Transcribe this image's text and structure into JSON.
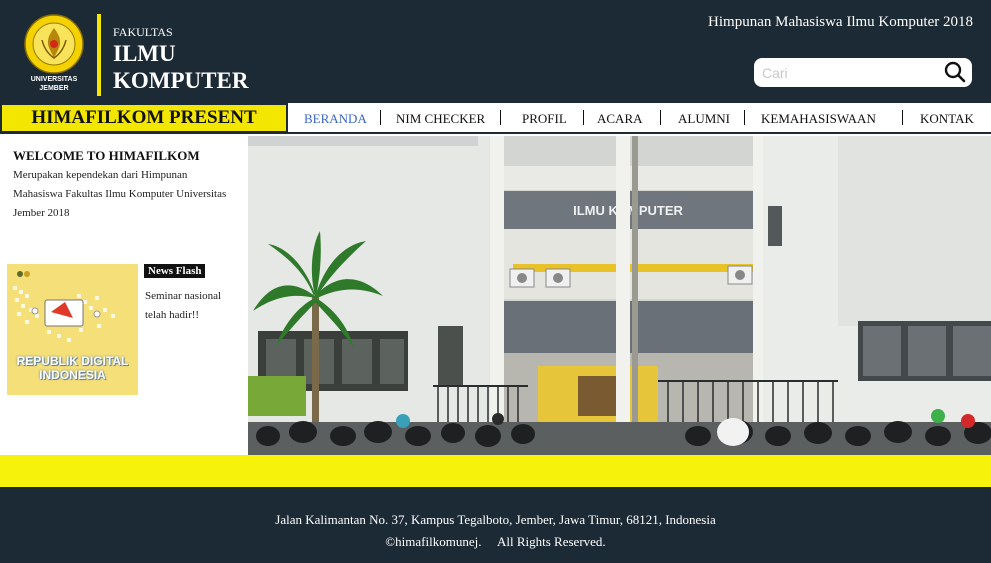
{
  "header": {
    "logo_text_line1": "UNIVERSITAS",
    "logo_text_line2": "JEMBER",
    "faculty_small": "FAKULTAS",
    "faculty_line1": "ILMU",
    "faculty_line2": "KOMPUTER",
    "org_title": "Himpunan Mahasiswa Ilmu Komputer 2018",
    "search_placeholder": "Cari"
  },
  "nav": {
    "present_label": "HIMAFILKOM PRESENT",
    "items": [
      "BERANDA",
      "NIM CHECKER",
      "PROFIL",
      "ACARA",
      "ALUMNI",
      "KEMAHASISWAAN",
      "KONTAK"
    ],
    "active": "BERANDA"
  },
  "sidebar": {
    "welcome_title": "WELCOME TO HIMAFILKOM",
    "welcome_text": "Merupakan kependekan dari Himpunan Mahasiswa Fakultas Ilmu Komputer Universitas Jember 2018",
    "thumb_caption_line1": "REPUBLIK DIGITAL",
    "thumb_caption_line2": "INDONESIA",
    "news_badge": "News Flash",
    "news_text": "Seminar nasional telah hadir!!"
  },
  "hero": {
    "building_sign": "ILMU KOMPUTER"
  },
  "footer": {
    "address": "Jalan Kalimantan No. 37, Kampus Tegalboto, Jember, Jawa Timur, 68121, Indonesia",
    "copyright": "©himafilkomunej.     All Rights Reserved."
  },
  "colors": {
    "dark": "#1c2a36",
    "yellow": "#f3e600",
    "band_yellow": "#f7f20c",
    "active_nav": "#3a67c9"
  }
}
